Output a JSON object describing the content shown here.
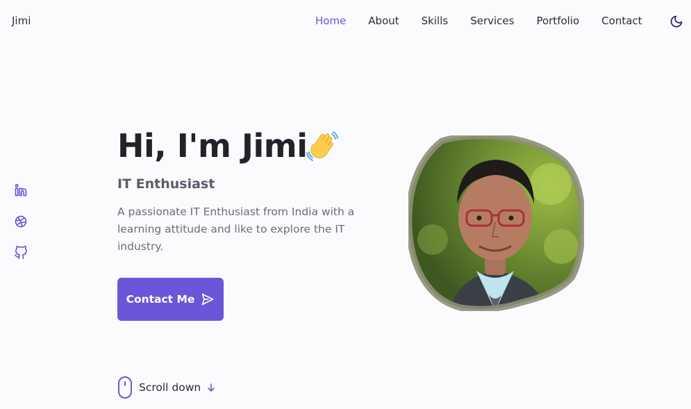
{
  "header": {
    "logo": "Jimi",
    "nav": [
      {
        "label": "Home",
        "active": true
      },
      {
        "label": "About",
        "active": false
      },
      {
        "label": "Skills",
        "active": false
      },
      {
        "label": "Services",
        "active": false
      },
      {
        "label": "Portfolio",
        "active": false
      },
      {
        "label": "Contact",
        "active": false
      }
    ],
    "theme_toggle_icon": "moon-icon"
  },
  "social": [
    {
      "icon": "linkedin-icon"
    },
    {
      "icon": "dribbble-icon"
    },
    {
      "icon": "github-icon"
    }
  ],
  "hero": {
    "title": "Hi, I'm Jimi",
    "wave_icon": "waving-hand-icon",
    "subtitle": "IT Enthusiast",
    "description": "A passionate IT Enthusiast from India with a learning attitude and like to explore the IT industry.",
    "button_label": "Contact Me",
    "button_icon": "send-icon",
    "profile_image": "profile-photo"
  },
  "scroll": {
    "label": "Scroll down",
    "icons": [
      "mouse-icon",
      "arrow-down-icon"
    ]
  },
  "colors": {
    "accent": "#6c55d8",
    "background": "#fbfbfe",
    "title": "#22222c",
    "text": "#6b6b7a"
  }
}
